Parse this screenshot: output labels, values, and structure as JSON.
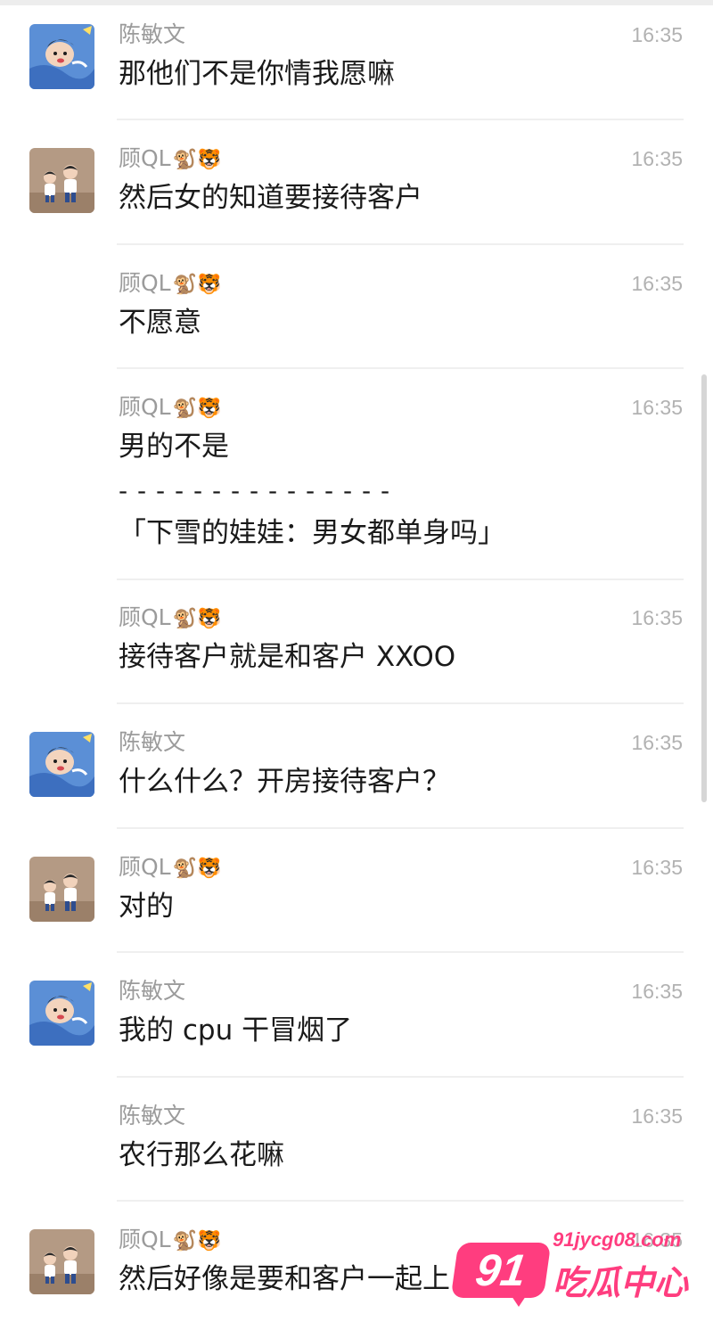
{
  "messages": [
    {
      "sender": "陈敏文",
      "emoji": "",
      "time": "16:35",
      "text": "那他们不是你情我愿嘛",
      "avatar": "chen-avatar"
    },
    {
      "sender": "顾QL",
      "emoji": "🐒🐯",
      "time": "16:35",
      "text": "然后女的知道要接待客户",
      "avatar": "gu-avatar"
    },
    {
      "sender": "顾QL",
      "emoji": "🐒🐯",
      "time": "16:35",
      "text": "不愿意",
      "avatar": ""
    },
    {
      "sender": "顾QL",
      "emoji": "🐒🐯",
      "time": "16:35",
      "text": "男的不是",
      "avatar": "",
      "quote_separator": "- - - - - - - - - - - - - - -",
      "quote": "「下雪的娃娃：男女都单身吗」"
    },
    {
      "sender": "顾QL",
      "emoji": "🐒🐯",
      "time": "16:35",
      "text": "接待客户就是和客户 XXOO",
      "avatar": ""
    },
    {
      "sender": "陈敏文",
      "emoji": "",
      "time": "16:35",
      "text": "什么什么？开房接待客户？",
      "avatar": "chen-avatar"
    },
    {
      "sender": "顾QL",
      "emoji": "🐒🐯",
      "time": "16:35",
      "text": "对的",
      "avatar": "gu-avatar"
    },
    {
      "sender": "陈敏文",
      "emoji": "",
      "time": "16:35",
      "text": "我的 cpu 干冒烟了",
      "avatar": "chen-avatar"
    },
    {
      "sender": "陈敏文",
      "emoji": "",
      "time": "16:35",
      "text": "农行那么花嘛",
      "avatar": ""
    },
    {
      "sender": "顾QL",
      "emoji": "🐒🐯",
      "time": "16:35",
      "text": "然后好像是要和客户一起上",
      "avatar": "gu-avatar"
    }
  ],
  "watermark": {
    "badge": "91",
    "url": "91jycg08.com",
    "label": "吃瓜中心"
  },
  "colors": {
    "name": "#9b9b9b",
    "time": "#b2b2b2",
    "text": "#1a1a1a",
    "divider": "#efefef",
    "watermark": "#ff3d7f"
  }
}
